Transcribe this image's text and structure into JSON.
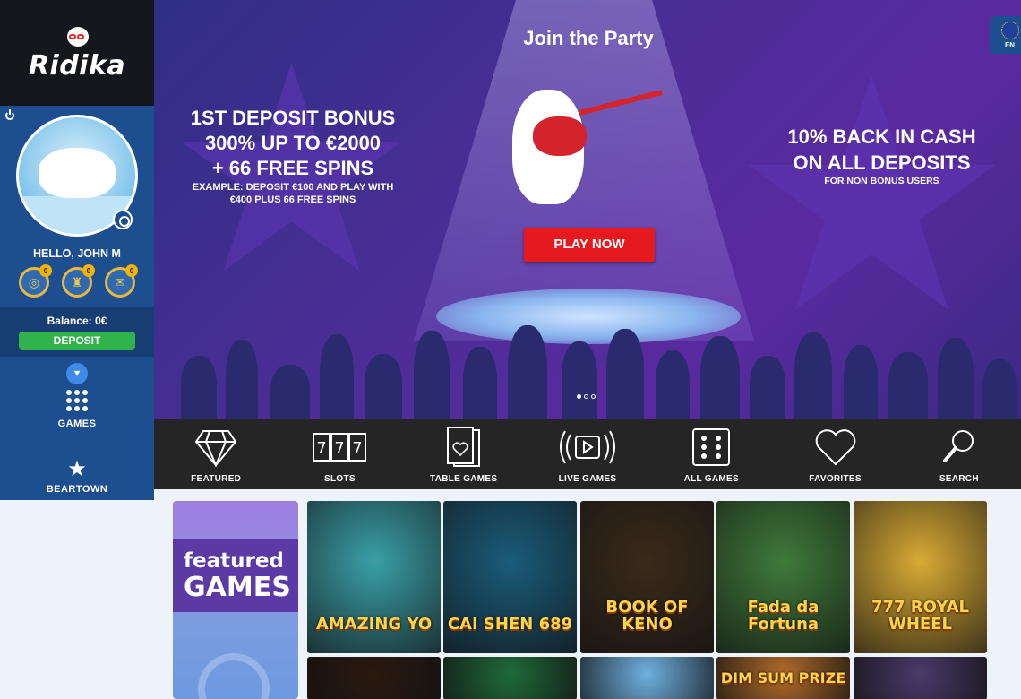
{
  "brand": {
    "logo_text": "Ridika"
  },
  "user": {
    "greeting": "HELLO, JOHN M",
    "balance": "Balance: 0€",
    "deposit_label": "DEPOSIT"
  },
  "badges": [
    {
      "icon": "coin-icon",
      "count": "0"
    },
    {
      "icon": "trophy-icon",
      "count": "0"
    },
    {
      "icon": "mail-icon",
      "count": "0"
    }
  ],
  "sidebar_nav": [
    {
      "icon": "grid-icon",
      "label": "GAMES"
    },
    {
      "icon": "star-icon",
      "label": "BEARTOWN"
    }
  ],
  "hero": {
    "title": "Join the Party",
    "left_lines": [
      "1ST DEPOSIT BONUS",
      "300% UP TO €2000",
      "+ 66 FREE SPINS"
    ],
    "left_small": [
      "EXAMPLE: DEPOSIT €100 AND PLAY WITH",
      "€400 PLUS 66 FREE SPINS"
    ],
    "right_lines": [
      "10% BACK IN CASH",
      "ON ALL DEPOSITS"
    ],
    "right_small": "FOR NON BONUS USERS",
    "cta": "PLAY NOW",
    "slide_count": 3,
    "active_slide": 1
  },
  "language": {
    "code": "EN"
  },
  "categories": [
    {
      "icon": "diamond-icon",
      "label": "FEATURED"
    },
    {
      "icon": "slots-icon",
      "label": "SLOTS"
    },
    {
      "icon": "card-icon",
      "label": "TABLE GAMES"
    },
    {
      "icon": "live-icon",
      "label": "LIVE GAMES"
    },
    {
      "icon": "dice-icon",
      "label": "ALL GAMES"
    },
    {
      "icon": "heart-icon",
      "label": "FAVORITES"
    },
    {
      "icon": "search-icon",
      "label": "SEARCH"
    }
  ],
  "featured": {
    "label_top": "featured",
    "label_bottom": "GAMES"
  },
  "games": [
    {
      "name": "AMAZING YO",
      "bg": "#3aa0a8"
    },
    {
      "name": "CAI SHEN 689",
      "bg": "#1a5c7a"
    },
    {
      "name": "BOOK OF KENO",
      "bg": "#3a2a1a"
    },
    {
      "name": "Fada da Fortuna",
      "bg": "#3f7a3a"
    },
    {
      "name": "777 ROYAL WHEEL",
      "bg": "#d9ab35"
    }
  ],
  "games_row2": [
    {
      "name": "",
      "bg": "#2a1a10"
    },
    {
      "name": "",
      "bg": "#1f6a3a"
    },
    {
      "name": "",
      "bg": "#6fb0e0"
    },
    {
      "name": "DIM SUM PRIZE",
      "bg": "#b06a2a"
    },
    {
      "name": "",
      "bg": "#4a3a6a"
    }
  ]
}
